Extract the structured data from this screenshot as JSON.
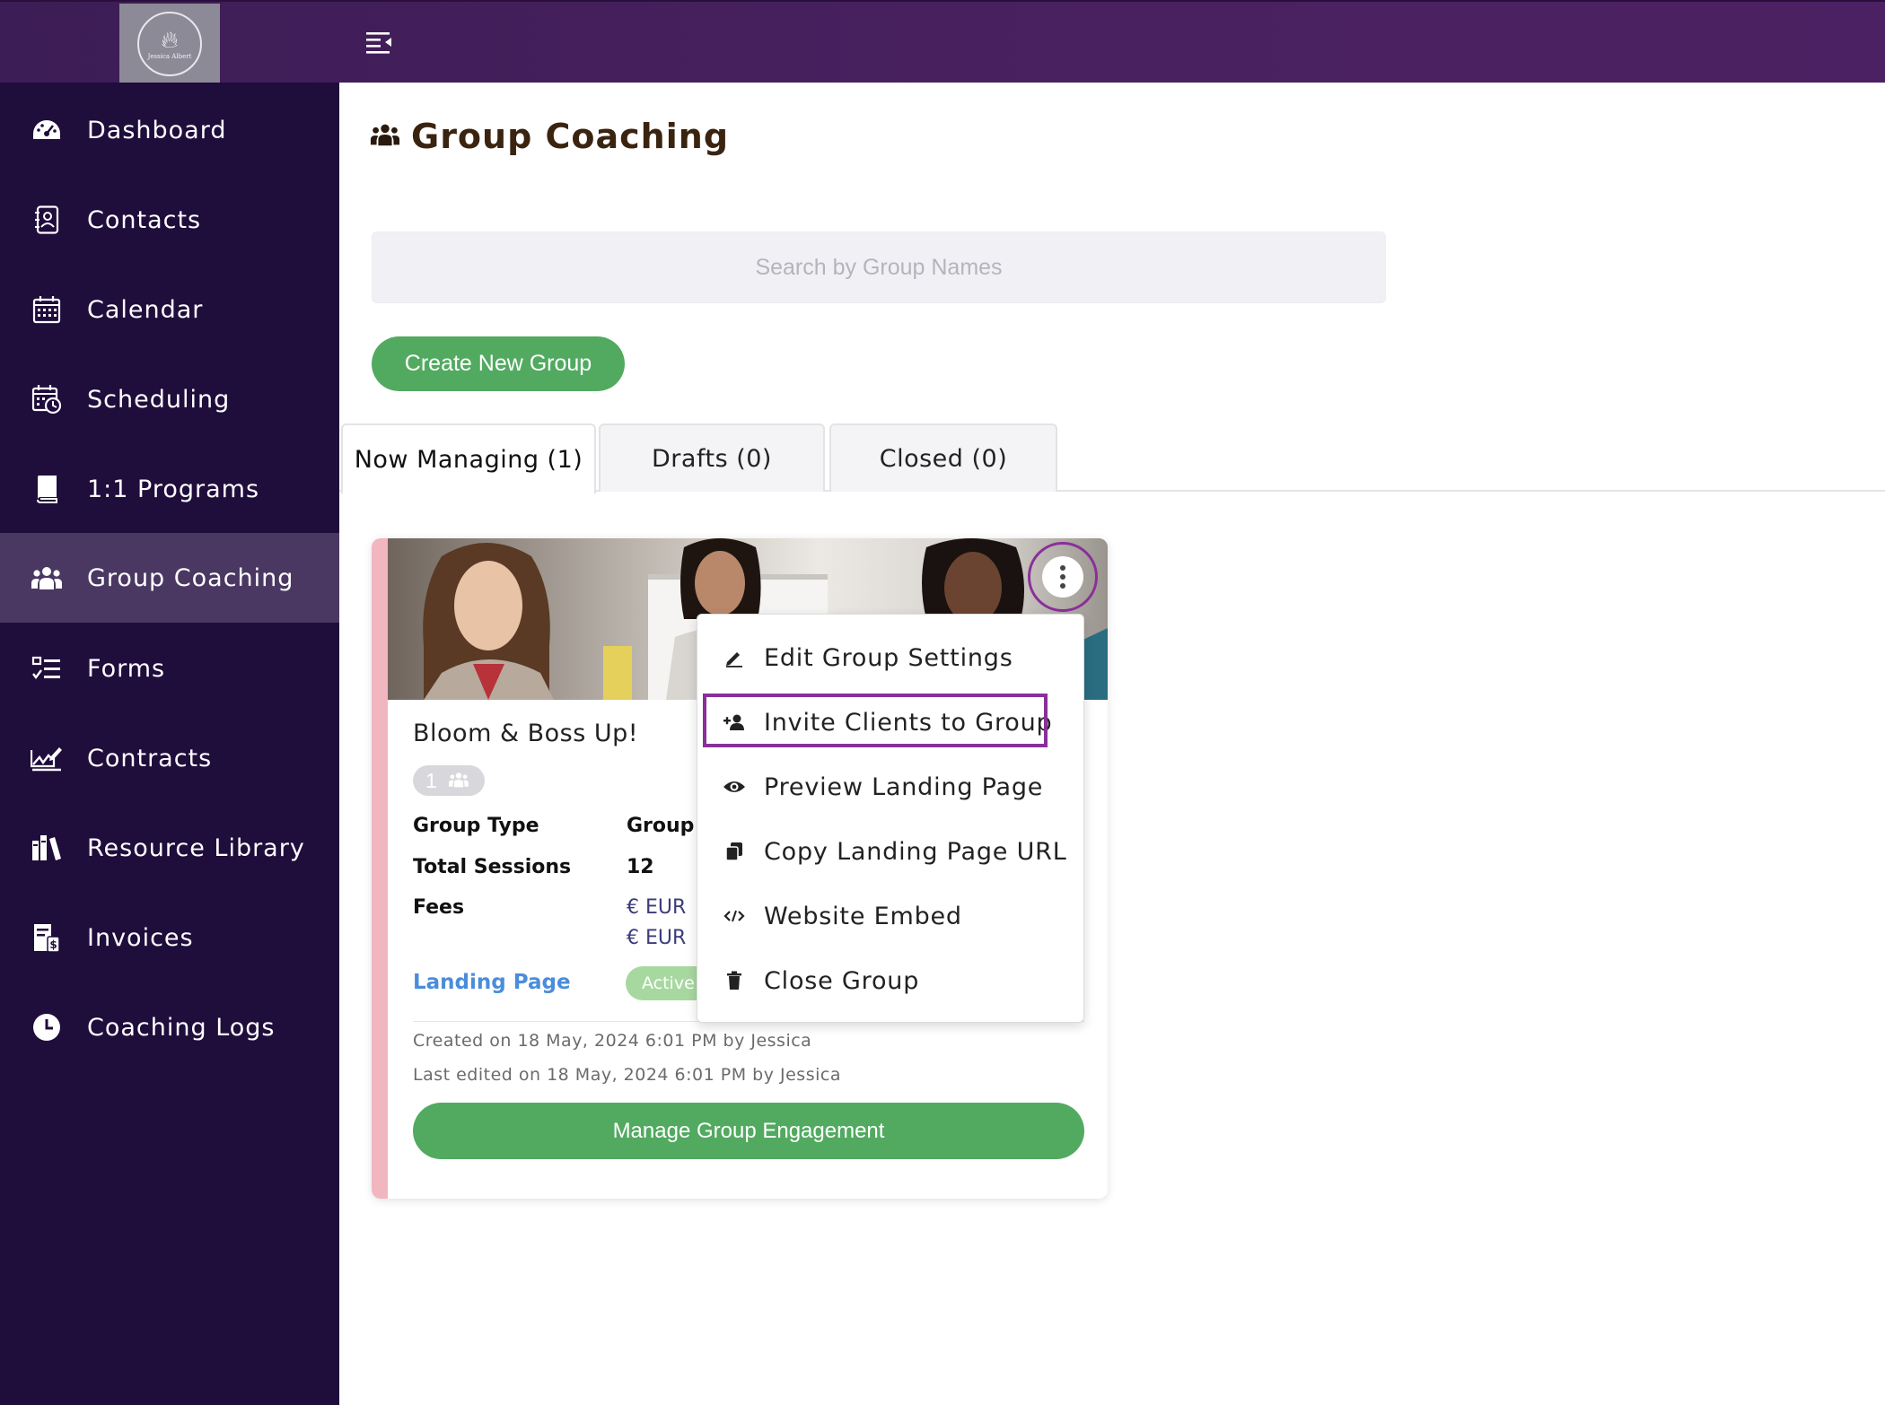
{
  "header": {
    "logo_text": "Jessica Albert",
    "menu_toggle_icon": "menu-collapse-icon"
  },
  "sidebar": {
    "items": [
      {
        "label": "Dashboard",
        "icon": "dashboard-gauge-icon"
      },
      {
        "label": "Contacts",
        "icon": "address-book-icon"
      },
      {
        "label": "Calendar",
        "icon": "calendar-icon"
      },
      {
        "label": "Scheduling",
        "icon": "calendar-clock-icon"
      },
      {
        "label": "1:1 Programs",
        "icon": "book-icon"
      },
      {
        "label": "Group Coaching",
        "icon": "users-icon",
        "active": true
      },
      {
        "label": "Forms",
        "icon": "checklist-icon"
      },
      {
        "label": "Contracts",
        "icon": "signature-icon"
      },
      {
        "label": "Resource Library",
        "icon": "library-icon"
      },
      {
        "label": "Invoices",
        "icon": "invoice-icon"
      },
      {
        "label": "Coaching Logs",
        "icon": "clock-icon"
      }
    ]
  },
  "main": {
    "title": "Group Coaching",
    "search_placeholder": "Search by Group Names",
    "create_button": "Create New Group",
    "tabs": [
      {
        "label": "Now Managing (1)",
        "active": true
      },
      {
        "label": "Drafts (0)"
      },
      {
        "label": "Closed (0)"
      }
    ]
  },
  "card": {
    "name": "Bloom & Boss Up!",
    "member_count": "1",
    "rows": [
      {
        "label": "Group Type",
        "value": "Group"
      },
      {
        "label": "Total Sessions",
        "value": "12"
      },
      {
        "label": "Fees",
        "value": "€ EUR",
        "value2": "€ EUR"
      }
    ],
    "landing_link": "Landing Page",
    "status": "Active",
    "created": "Created on 18 May, 2024 6:01 PM by Jessica",
    "edited": "Last edited on 18 May, 2024 6:01 PM by Jessica",
    "manage_button": "Manage Group Engagement"
  },
  "dropdown": {
    "items": [
      {
        "label": "Edit Group Settings",
        "icon": "pencil-icon"
      },
      {
        "label": "Invite Clients to Group",
        "icon": "user-plus-icon",
        "highlighted": true
      },
      {
        "label": "Preview Landing Page",
        "icon": "eye-icon"
      },
      {
        "label": "Copy Landing Page URL",
        "icon": "copy-icon"
      },
      {
        "label": "Website Embed",
        "icon": "code-icon"
      },
      {
        "label": "Close Group",
        "icon": "trash-icon"
      }
    ]
  },
  "colors": {
    "topbar": "#4a2160",
    "sidebar": "#1f0d3b",
    "sidebar_active": "#4a3862",
    "primary_green": "#52aa60",
    "highlight_purple": "#8a2f9a",
    "card_stripe": "#f2b6c0"
  }
}
